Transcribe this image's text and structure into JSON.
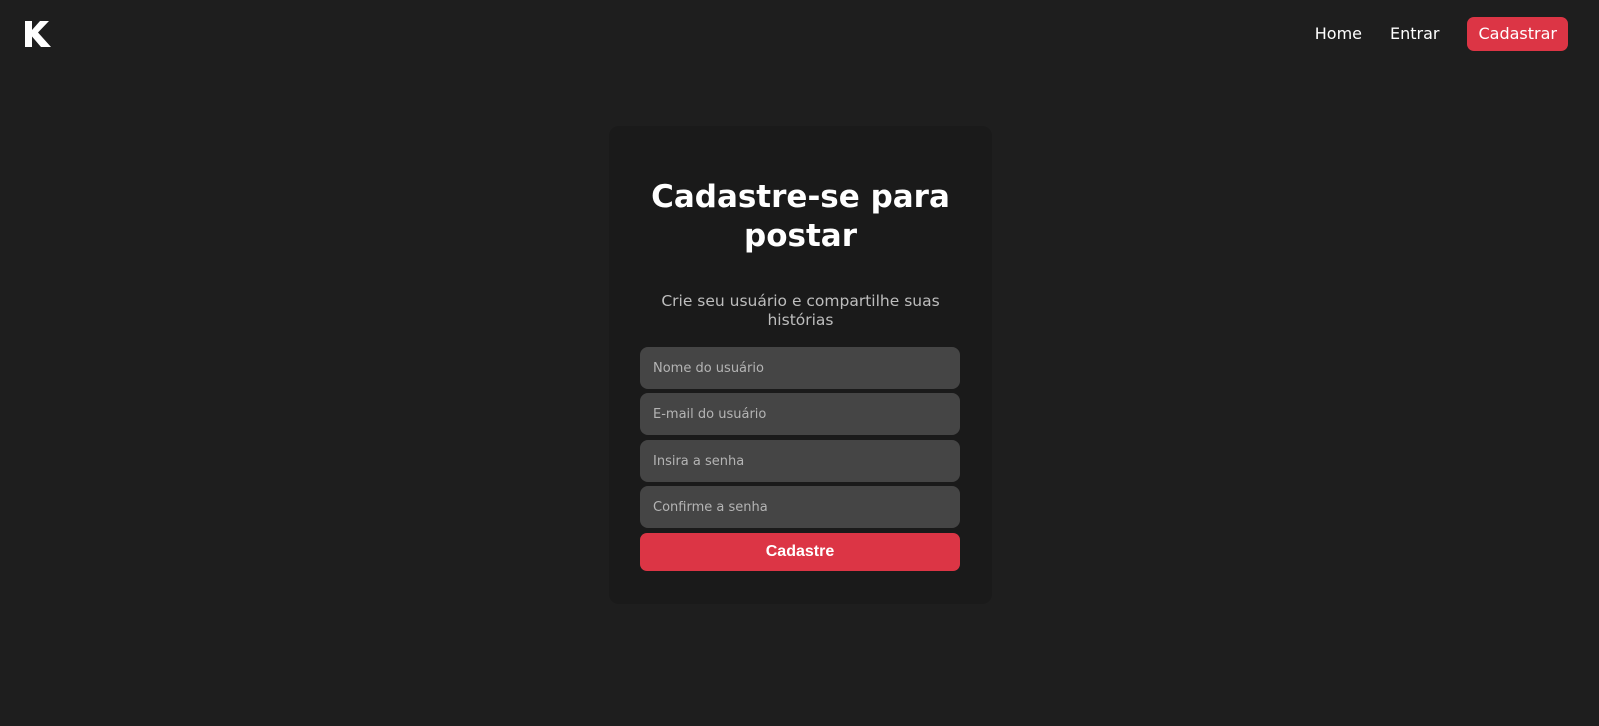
{
  "nav": {
    "logo_icon": "k-logo-icon",
    "home_label": "Home",
    "login_label": "Entrar",
    "signup_label": "Cadastrar"
  },
  "form": {
    "title": "Cadastre-se para postar",
    "subtitle": "Crie seu usuário e compartilhe suas histórias",
    "username_placeholder": "Nome do usuário",
    "username_value": "",
    "email_placeholder": "E-mail do usuário",
    "email_value": "",
    "password_placeholder": "Insira a senha",
    "password_value": "",
    "confirm_placeholder": "Confirme a senha",
    "confirm_value": "",
    "submit_label": "Cadastre"
  },
  "colors": {
    "background": "#1e1e1e",
    "card": "#1a1a1a",
    "input": "#454545",
    "accent": "#dc3545"
  }
}
